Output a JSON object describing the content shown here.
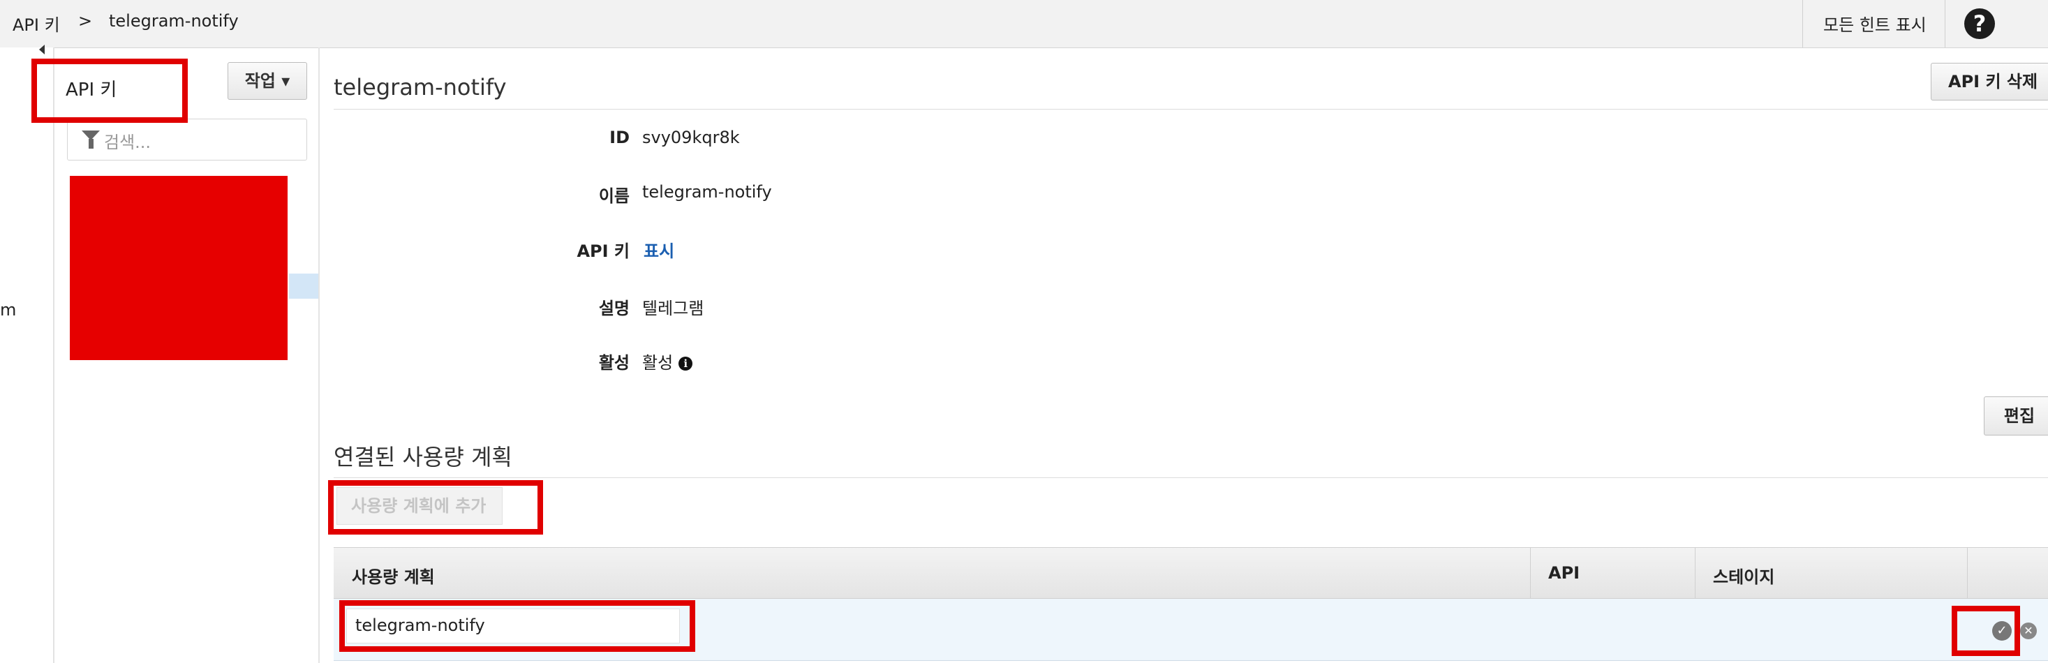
{
  "breadcrumb": {
    "root": "API 키",
    "separator": ">",
    "current": "telegram-notify"
  },
  "header": {
    "hints_label": "모든 힌트 표시",
    "help_glyph": "?"
  },
  "left_stub_text": "m",
  "list_panel": {
    "title": "API 키",
    "action_label": "작업 ▾",
    "search_placeholder": "검색..."
  },
  "detail": {
    "title": "telegram-notify",
    "delete_label": "API 키 삭제",
    "fields": {
      "id": {
        "label": "ID",
        "value": "svy09kqr8k"
      },
      "name": {
        "label": "이름",
        "value": "telegram-notify"
      },
      "api_key": {
        "label": "API 키",
        "value": "표시"
      },
      "description": {
        "label": "설명",
        "value": "텔레그램"
      },
      "enabled": {
        "label": "활성",
        "value": "활성"
      }
    },
    "edit_label": "편집"
  },
  "usage_plans": {
    "section_title": "연결된 사용량 계획",
    "add_label": "사용량 계획에 추가",
    "columns": [
      "사용량 계획",
      "API",
      "스테이지"
    ],
    "rows": [
      {
        "plan": "telegram-notify",
        "api": "",
        "stage": ""
      }
    ]
  },
  "colors": {
    "highlight": "#e00000",
    "link": "#1a5eb0",
    "selected_row": "#eef6fc"
  }
}
